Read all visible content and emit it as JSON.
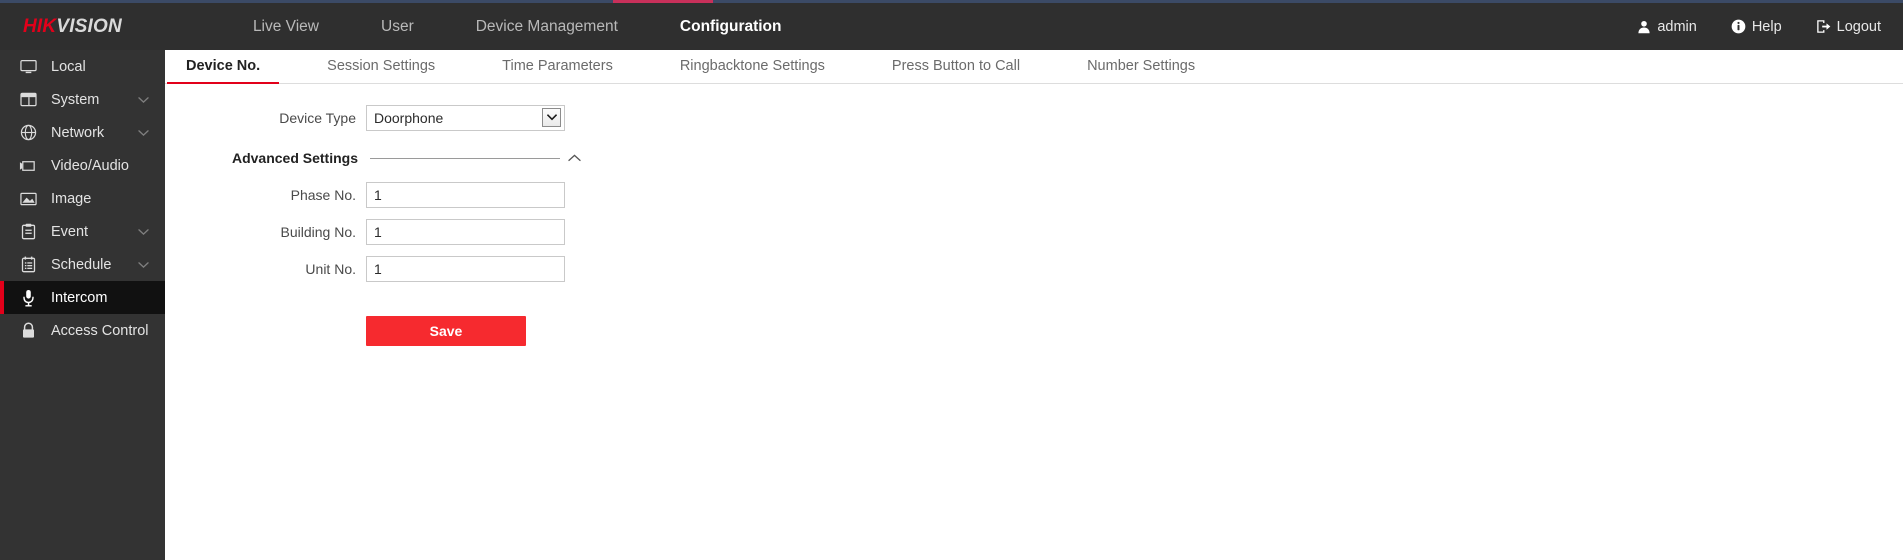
{
  "brand": {
    "part1": "HIK",
    "part2": "VISION"
  },
  "header": {
    "nav": [
      {
        "label": "Live View",
        "active": false
      },
      {
        "label": "User",
        "active": false
      },
      {
        "label": "Device Management",
        "active": false
      },
      {
        "label": "Configuration",
        "active": true
      }
    ],
    "right": [
      {
        "label": "admin",
        "icon": "user-icon"
      },
      {
        "label": "Help",
        "icon": "info-icon"
      },
      {
        "label": "Logout",
        "icon": "logout-icon"
      }
    ],
    "accent_color": "#c8305a",
    "strip_color": "#3b4a66"
  },
  "sidebar": {
    "items": [
      {
        "label": "Local",
        "icon": "monitor-icon",
        "expandable": false,
        "active": false
      },
      {
        "label": "System",
        "icon": "window-icon",
        "expandable": true,
        "active": false
      },
      {
        "label": "Network",
        "icon": "globe-icon",
        "expandable": true,
        "active": false
      },
      {
        "label": "Video/Audio",
        "icon": "camera-icon",
        "expandable": false,
        "active": false
      },
      {
        "label": "Image",
        "icon": "picture-icon",
        "expandable": false,
        "active": false
      },
      {
        "label": "Event",
        "icon": "clipboard-icon",
        "expandable": true,
        "active": false
      },
      {
        "label": "Schedule",
        "icon": "list-icon",
        "expandable": true,
        "active": false
      },
      {
        "label": "Intercom",
        "icon": "microphone-icon",
        "expandable": false,
        "active": true
      },
      {
        "label": "Access Control",
        "icon": "lock-icon",
        "expandable": false,
        "active": false
      }
    ],
    "active_marker_color": "#e2001a"
  },
  "tabs": [
    {
      "label": "Device No.",
      "active": true
    },
    {
      "label": "Session Settings",
      "active": false
    },
    {
      "label": "Time Parameters",
      "active": false
    },
    {
      "label": "Ringbacktone Settings",
      "active": false
    },
    {
      "label": "Press Button to Call",
      "active": false
    },
    {
      "label": "Number Settings",
      "active": false
    }
  ],
  "form": {
    "device_type": {
      "label": "Device Type",
      "value": "Doorphone",
      "options": [
        "Doorphone"
      ]
    },
    "advanced": {
      "title": "Advanced Settings",
      "expanded": true,
      "caret": "chevron-up-icon"
    },
    "fields": [
      {
        "label": "Phase No.",
        "value": "1",
        "name": "phase-no"
      },
      {
        "label": "Building No.",
        "value": "1",
        "name": "building-no"
      },
      {
        "label": "Unit No.",
        "value": "1",
        "name": "unit-no"
      }
    ],
    "save_label": "Save",
    "save_color": "#f62a2f"
  }
}
